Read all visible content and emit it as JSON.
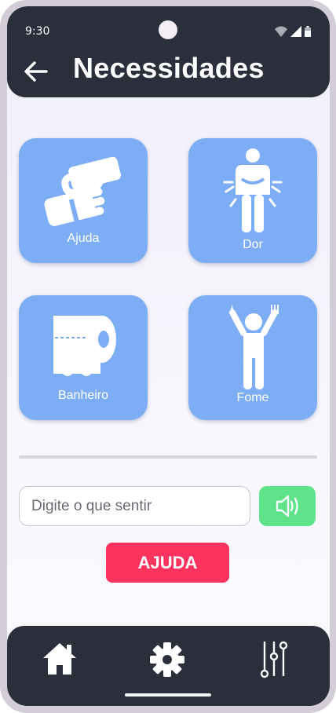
{
  "status_bar": {
    "time": "9:30"
  },
  "header": {
    "title": "Necessidades",
    "back_icon": "arrow-left-icon"
  },
  "tiles": [
    {
      "label": "Ajuda",
      "icon": "handshake-icon"
    },
    {
      "label": "Dor",
      "icon": "pain-person-icon"
    },
    {
      "label": "Banheiro",
      "icon": "toilet-paper-icon"
    },
    {
      "label": "Fome",
      "icon": "hungry-person-icon"
    }
  ],
  "input": {
    "placeholder": "Digite o que sentir",
    "value": ""
  },
  "speak_button": {
    "icon": "speaker-icon"
  },
  "help_button": {
    "label": "AJUDA"
  },
  "bottom_nav": [
    {
      "icon": "home-icon"
    },
    {
      "icon": "gear-icon"
    },
    {
      "icon": "sliders-icon"
    }
  ],
  "colors": {
    "appbar": "#2a2f3b",
    "tile": "#7daef5",
    "speak": "#5ee28a",
    "help": "#fb335e"
  }
}
